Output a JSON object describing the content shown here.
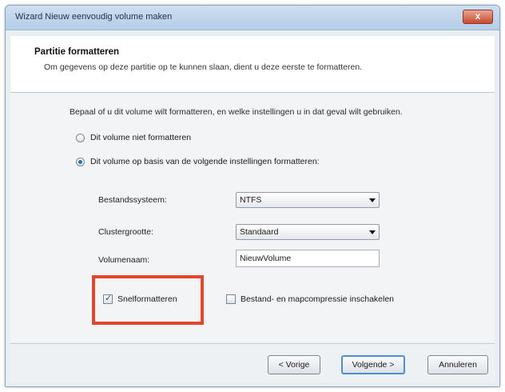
{
  "window": {
    "title": "Wizard Nieuw eenvoudig volume maken",
    "close_glyph": "x"
  },
  "header": {
    "title": "Partitie formatteren",
    "description": "Om gegevens op deze partitie op te kunnen slaan, dient u deze eerste te formatteren."
  },
  "content": {
    "instruction": "Bepaal of u dit volume wilt formatteren, en welke instellingen u in dat geval wilt gebruiken.",
    "radio_no_format": "Dit volume niet formatteren",
    "radio_format": "Dit volume op basis van de volgende instellingen formatteren:",
    "filesystem_label": "Bestandssysteem:",
    "filesystem_value": "NTFS",
    "cluster_label": "Clustergrootte:",
    "cluster_value": "Standaard",
    "volume_label": "Volumenaam:",
    "volume_value": "NieuwVolume",
    "quick_format_label": "Snelformatteren",
    "quick_format_checked": true,
    "compression_label": "Bestand- en mapcompressie inschakelen",
    "compression_checked": false
  },
  "footer": {
    "back_label": "< Vorige",
    "next_label": "Volgende >",
    "cancel_label": "Annuleren"
  },
  "colors": {
    "highlight": "#e2462b",
    "accent": "#4f8fd0"
  }
}
